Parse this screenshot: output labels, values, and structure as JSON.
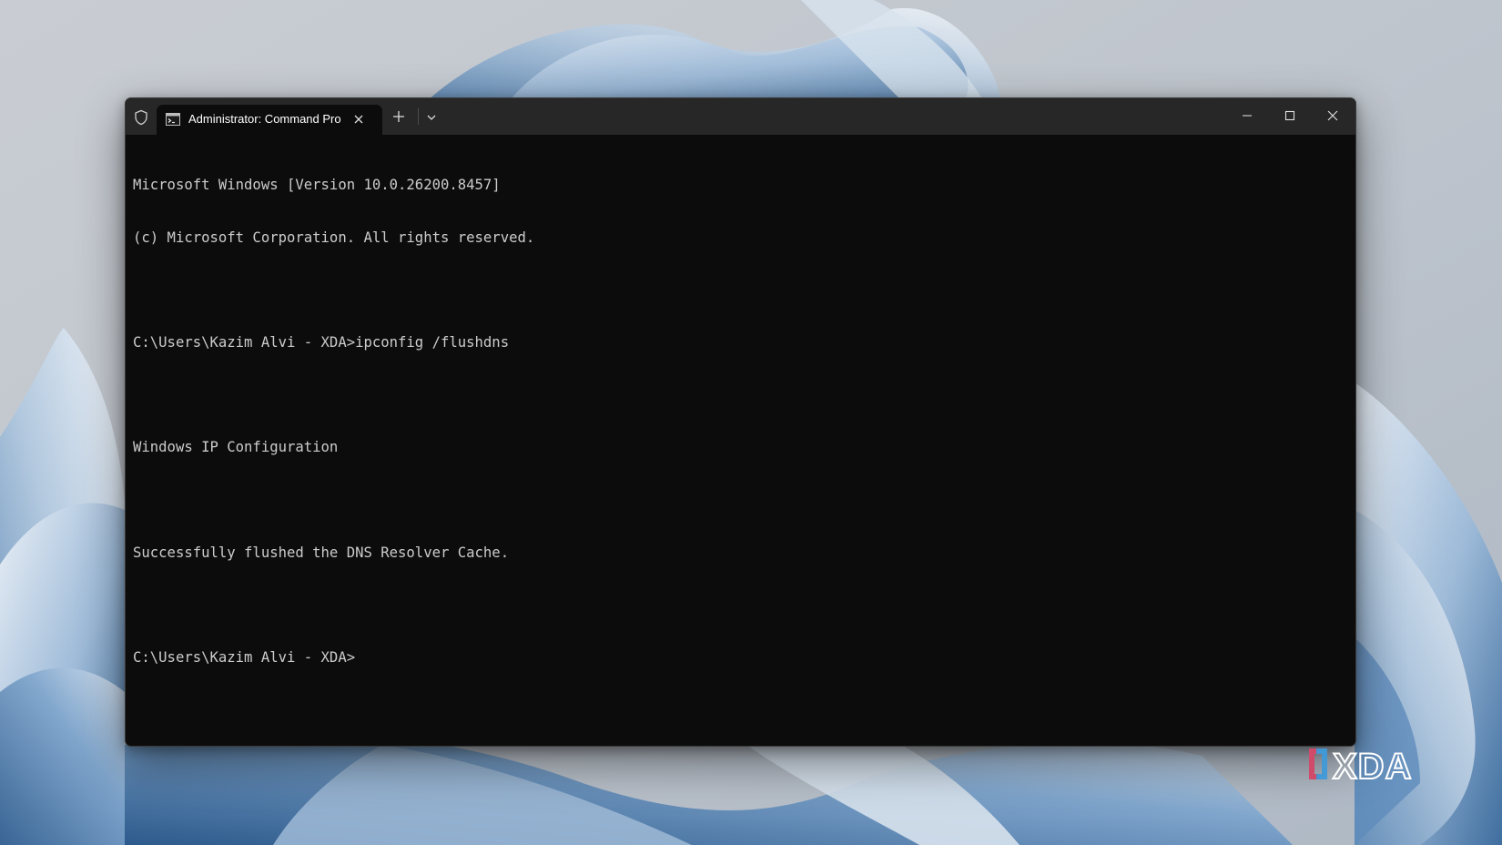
{
  "window": {
    "tab_title": "Administrator: Command Pro",
    "icons": {
      "shield": "shield-icon",
      "tab": "terminal-icon",
      "tab_close": "close-icon",
      "new_tab": "plus-icon",
      "dropdown": "chevron-down-icon",
      "minimize": "minimize-icon",
      "maximize": "maximize-icon",
      "close": "close-icon"
    }
  },
  "console": {
    "lines": [
      "Microsoft Windows [Version 10.0.26200.8457]",
      "(c) Microsoft Corporation. All rights reserved.",
      "",
      "C:\\Users\\Kazim Alvi - XDA>ipconfig /flushdns",
      "",
      "Windows IP Configuration",
      "",
      "Successfully flushed the DNS Resolver Cache.",
      "",
      "C:\\Users\\Kazim Alvi - XDA>"
    ]
  },
  "watermark": {
    "text": "XDA",
    "icon": "xda-logo"
  },
  "colors": {
    "terminal_bg": "#0c0c0c",
    "titlebar_bg": "#272727",
    "console_text": "#cccccc",
    "desktop_bg": "#c3c8cf",
    "bloom": "#6f9cc7"
  }
}
